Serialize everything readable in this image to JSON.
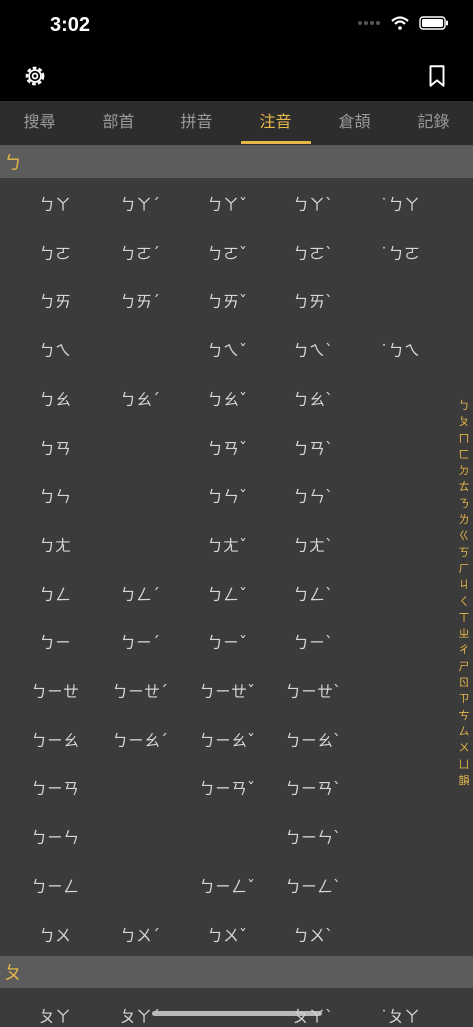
{
  "status_bar": {
    "time": "3:02"
  },
  "tabs": [
    {
      "label": "搜尋",
      "active": false
    },
    {
      "label": "部首",
      "active": false
    },
    {
      "label": "拼音",
      "active": false
    },
    {
      "label": "注音",
      "active": true
    },
    {
      "label": "倉頡",
      "active": false
    },
    {
      "label": "記錄",
      "active": false
    }
  ],
  "sections": [
    {
      "header": "ㄅ",
      "rows": [
        [
          "ㄅㄚ",
          "ㄅㄚˊ",
          "ㄅㄚˇ",
          "ㄅㄚˋ",
          "˙ㄅㄚ"
        ],
        [
          "ㄅㄛ",
          "ㄅㄛˊ",
          "ㄅㄛˇ",
          "ㄅㄛˋ",
          "˙ㄅㄛ"
        ],
        [
          "ㄅㄞ",
          "ㄅㄞˊ",
          "ㄅㄞˇ",
          "ㄅㄞˋ",
          ""
        ],
        [
          "ㄅㄟ",
          "",
          "ㄅㄟˇ",
          "ㄅㄟˋ",
          "˙ㄅㄟ"
        ],
        [
          "ㄅㄠ",
          "ㄅㄠˊ",
          "ㄅㄠˇ",
          "ㄅㄠˋ",
          ""
        ],
        [
          "ㄅㄢ",
          "",
          "ㄅㄢˇ",
          "ㄅㄢˋ",
          ""
        ],
        [
          "ㄅㄣ",
          "",
          "ㄅㄣˇ",
          "ㄅㄣˋ",
          ""
        ],
        [
          "ㄅㄤ",
          "",
          "ㄅㄤˇ",
          "ㄅㄤˋ",
          ""
        ],
        [
          "ㄅㄥ",
          "ㄅㄥˊ",
          "ㄅㄥˇ",
          "ㄅㄥˋ",
          ""
        ],
        [
          "ㄅㄧ",
          "ㄅㄧˊ",
          "ㄅㄧˇ",
          "ㄅㄧˋ",
          ""
        ],
        [
          "ㄅㄧㄝ",
          "ㄅㄧㄝˊ",
          "ㄅㄧㄝˇ",
          "ㄅㄧㄝˋ",
          ""
        ],
        [
          "ㄅㄧㄠ",
          "ㄅㄧㄠˊ",
          "ㄅㄧㄠˇ",
          "ㄅㄧㄠˋ",
          ""
        ],
        [
          "ㄅㄧㄢ",
          "",
          "ㄅㄧㄢˇ",
          "ㄅㄧㄢˋ",
          ""
        ],
        [
          "ㄅㄧㄣ",
          "",
          "",
          "ㄅㄧㄣˋ",
          ""
        ],
        [
          "ㄅㄧㄥ",
          "",
          "ㄅㄧㄥˇ",
          "ㄅㄧㄥˋ",
          ""
        ],
        [
          "ㄅㄨ",
          "ㄅㄨˊ",
          "ㄅㄨˇ",
          "ㄅㄨˋ",
          ""
        ]
      ]
    },
    {
      "header": "ㄆ",
      "rows": [
        [
          "ㄆㄚ",
          "ㄆㄚˊ",
          "",
          "ㄆㄚˋ",
          "˙ㄆㄚ"
        ]
      ]
    }
  ],
  "index_bar": [
    "ㄅ",
    "ㄆ",
    "ㄇ",
    "ㄈ",
    "ㄉ",
    "ㄊ",
    "ㄋ",
    "ㄌ",
    "ㄍ",
    "ㄎ",
    "ㄏ",
    "ㄐ",
    "ㄑ",
    "ㄒ",
    "ㄓ",
    "ㄔ",
    "ㄕ",
    "ㄖ",
    "ㄗ",
    "ㄘ",
    "ㄙ",
    "ㄨ",
    "ㄩ",
    "韻"
  ],
  "colors": {
    "accent": "#e6b74b",
    "background": "#3b3b3b",
    "section_header": "#5c5c5c",
    "bar": "#000000"
  }
}
